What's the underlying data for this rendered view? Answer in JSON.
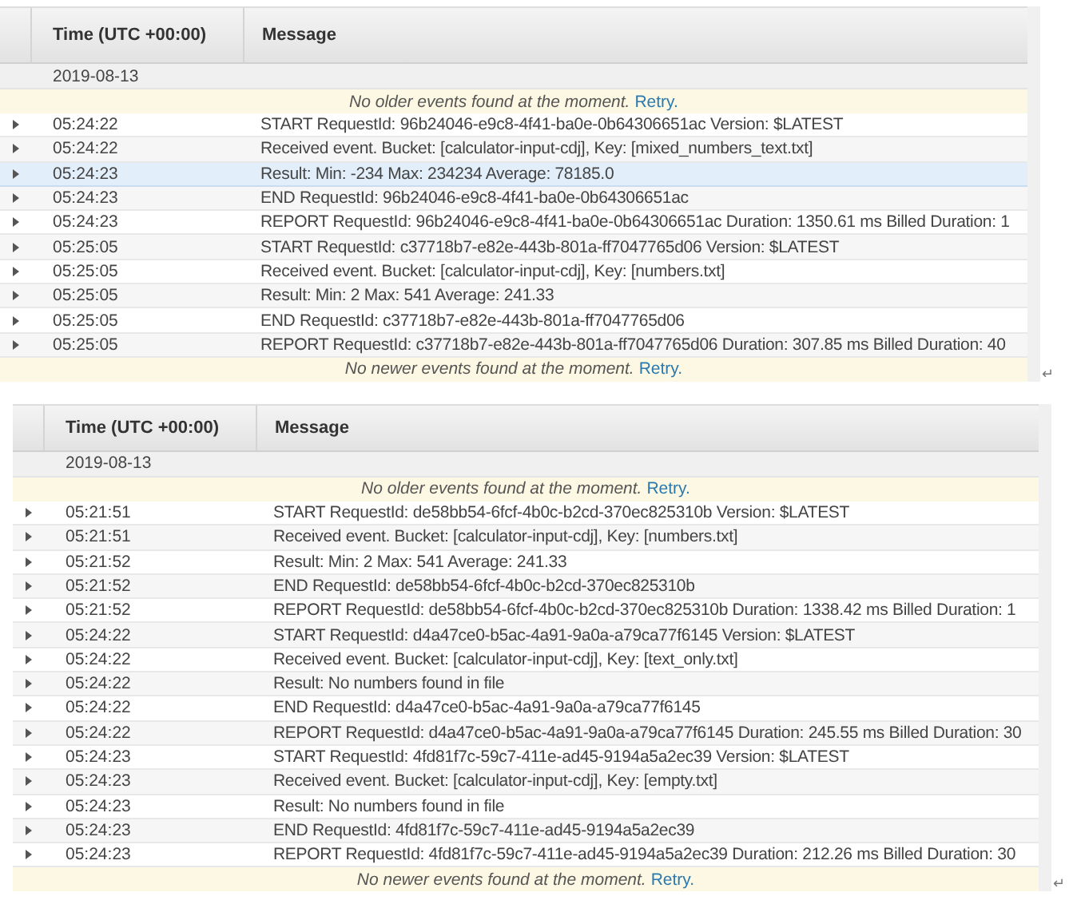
{
  "panels": [
    {
      "columns": [
        "Time (UTC +00:00)",
        "Message"
      ],
      "date": "2019-08-13",
      "older_notice": {
        "text": "No older events found at the moment.",
        "link": "Retry."
      },
      "rows": [
        {
          "time": "05:24:22",
          "message": "START RequestId: 96b24046-e9c8-4f41-ba0e-0b64306651ac Version: $LATEST",
          "highlighted": false
        },
        {
          "time": "05:24:22",
          "message": "Received event. Bucket: [calculator-input-cdj], Key: [mixed_numbers_text.txt]",
          "highlighted": false
        },
        {
          "time": "05:24:23",
          "message": "Result: Min: -234 Max: 234234 Average: 78185.0",
          "highlighted": true
        },
        {
          "time": "05:24:23",
          "message": "END RequestId: 96b24046-e9c8-4f41-ba0e-0b64306651ac",
          "highlighted": false
        },
        {
          "time": "05:24:23",
          "message": "REPORT RequestId: 96b24046-e9c8-4f41-ba0e-0b64306651ac Duration: 1350.61 ms Billed Duration: 1",
          "highlighted": false
        },
        {
          "time": "05:25:05",
          "message": "START RequestId: c37718b7-e82e-443b-801a-ff7047765d06 Version: $LATEST",
          "highlighted": false
        },
        {
          "time": "05:25:05",
          "message": "Received event. Bucket: [calculator-input-cdj], Key: [numbers.txt]",
          "highlighted": false
        },
        {
          "time": "05:25:05",
          "message": "Result: Min: 2 Max: 541 Average: 241.33",
          "highlighted": false
        },
        {
          "time": "05:25:05",
          "message": "END RequestId: c37718b7-e82e-443b-801a-ff7047765d06",
          "highlighted": false
        },
        {
          "time": "05:25:05",
          "message": "REPORT RequestId: c37718b7-e82e-443b-801a-ff7047765d06 Duration: 307.85 ms Billed Duration: 40",
          "highlighted": false
        }
      ],
      "newer_notice": {
        "text": "No newer events found at the moment.",
        "link": "Retry."
      },
      "paragraph_mark": "↵"
    },
    {
      "columns": [
        "Time (UTC +00:00)",
        "Message"
      ],
      "date": "2019-08-13",
      "older_notice": {
        "text": "No older events found at the moment.",
        "link": "Retry."
      },
      "rows": [
        {
          "time": "05:21:51",
          "message": "START RequestId: de58bb54-6fcf-4b0c-b2cd-370ec825310b Version: $LATEST",
          "highlighted": false
        },
        {
          "time": "05:21:51",
          "message": "Received event. Bucket: [calculator-input-cdj], Key: [numbers.txt]",
          "highlighted": false
        },
        {
          "time": "05:21:52",
          "message": "Result: Min: 2 Max: 541 Average: 241.33",
          "highlighted": false
        },
        {
          "time": "05:21:52",
          "message": "END RequestId: de58bb54-6fcf-4b0c-b2cd-370ec825310b",
          "highlighted": false
        },
        {
          "time": "05:21:52",
          "message": "REPORT RequestId: de58bb54-6fcf-4b0c-b2cd-370ec825310b Duration: 1338.42 ms Billed Duration: 1",
          "highlighted": false
        },
        {
          "time": "05:24:22",
          "message": "START RequestId: d4a47ce0-b5ac-4a91-9a0a-a79ca77f6145 Version: $LATEST",
          "highlighted": false
        },
        {
          "time": "05:24:22",
          "message": "Received event. Bucket: [calculator-input-cdj], Key: [text_only.txt]",
          "highlighted": false
        },
        {
          "time": "05:24:22",
          "message": "Result: No numbers found in file",
          "highlighted": false
        },
        {
          "time": "05:24:22",
          "message": "END RequestId: d4a47ce0-b5ac-4a91-9a0a-a79ca77f6145",
          "highlighted": false
        },
        {
          "time": "05:24:22",
          "message": "REPORT RequestId: d4a47ce0-b5ac-4a91-9a0a-a79ca77f6145 Duration: 245.55 ms Billed Duration: 30",
          "highlighted": false
        },
        {
          "time": "05:24:23",
          "message": "START RequestId: 4fd81f7c-59c7-411e-ad45-9194a5a2ec39 Version: $LATEST",
          "highlighted": false
        },
        {
          "time": "05:24:23",
          "message": "Received event. Bucket: [calculator-input-cdj], Key: [empty.txt]",
          "highlighted": false
        },
        {
          "time": "05:24:23",
          "message": "Result: No numbers found in file",
          "highlighted": false
        },
        {
          "time": "05:24:23",
          "message": "END RequestId: 4fd81f7c-59c7-411e-ad45-9194a5a2ec39",
          "highlighted": false
        },
        {
          "time": "05:24:23",
          "message": "REPORT RequestId: 4fd81f7c-59c7-411e-ad45-9194a5a2ec39 Duration: 212.26 ms Billed Duration: 30",
          "highlighted": false
        }
      ],
      "newer_notice": {
        "text": "No newer events found at the moment.",
        "link": "Retry."
      },
      "paragraph_mark": "↵"
    }
  ]
}
